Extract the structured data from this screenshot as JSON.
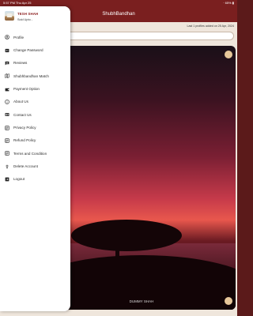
{
  "status_bar": {
    "time": "5:57 PM  Thu Apr 25",
    "right": "⋅ 65% ▮"
  },
  "app_bar": {
    "title": "ShubhBandhan"
  },
  "updated_text": "Last 1 profiles added on 25 Apr, 2024",
  "profile_card": {
    "caption": "DUMMY SHAH"
  },
  "drawer": {
    "user": {
      "name": "TESH SHAH",
      "status": "Sold Upto -"
    },
    "items": [
      {
        "label": "Profile",
        "icon": "person-icon"
      },
      {
        "label": "Change Password",
        "icon": "key-icon"
      },
      {
        "label": "Reviews",
        "icon": "review-icon"
      },
      {
        "label": "Shubhbandhan Match",
        "icon": "match-icon"
      },
      {
        "label": "Payment Option",
        "icon": "wallet-icon"
      },
      {
        "label": "About Us",
        "icon": "info-icon"
      },
      {
        "label": "Contact Us",
        "icon": "contact-card-icon"
      },
      {
        "label": "Privacy Policy",
        "icon": "privacy-icon"
      },
      {
        "label": "Refund Policy",
        "icon": "refund-icon"
      },
      {
        "label": "Terms and Condition",
        "icon": "terms-icon"
      },
      {
        "label": "Delete Account",
        "icon": "delete-account-icon"
      },
      {
        "label": "Logout",
        "icon": "logout-icon"
      }
    ]
  }
}
